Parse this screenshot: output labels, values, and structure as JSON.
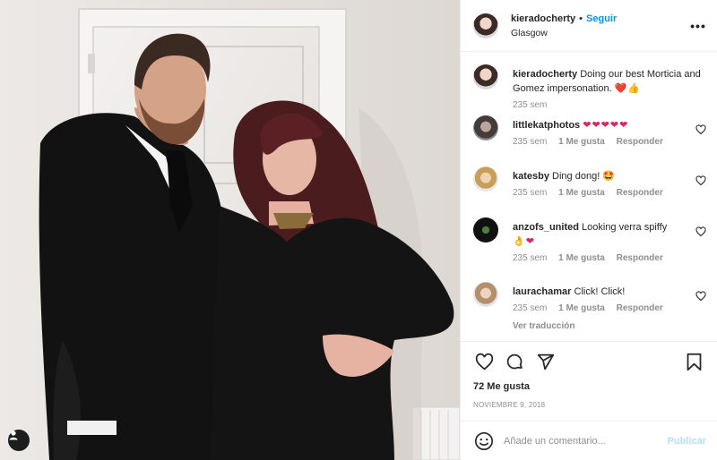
{
  "header": {
    "username": "kieradocherty",
    "separator": "•",
    "follow_label": "Seguir",
    "location": "Glasgow",
    "more_icon": "more-horizontal-icon"
  },
  "caption": {
    "username": "kieradocherty",
    "text": "Doing our best Morticia and Gomez impersonation.",
    "emoji": "❤️👍",
    "time": "235 sem"
  },
  "comments": [
    {
      "username": "littlekatphotos",
      "text": "",
      "emoji": "❤❤❤❤❤",
      "time": "235 sem",
      "likes": "1 Me gusta",
      "reply": "Responder"
    },
    {
      "username": "katesby",
      "text": "Ding dong!",
      "emoji": "🤩",
      "time": "235 sem",
      "likes": "1 Me gusta",
      "reply": "Responder"
    },
    {
      "username": "anzofs_united",
      "text": "Looking verra spiffy",
      "emoji": "👌❤",
      "time": "235 sem",
      "likes": "1 Me gusta",
      "reply": "Responder"
    },
    {
      "username": "laurachamar",
      "text": "Click! Click!",
      "emoji": "",
      "time": "235 sem",
      "likes": "1 Me gusta",
      "reply": "Responder",
      "translate": "Ver traducción"
    }
  ],
  "actions": {
    "like_icon": "heart-icon",
    "comment_icon": "comment-icon",
    "share_icon": "send-icon",
    "save_icon": "bookmark-icon"
  },
  "likes_label": "72 Me gusta",
  "date": "NOVIEMBRE 9, 2018",
  "add_comment": {
    "placeholder": "Añade un comentario...",
    "publish_label": "Publicar"
  },
  "colors": {
    "accent": "#0095f6",
    "publish_disabled": "#b2dffc",
    "muted": "#8e8e8e",
    "heart": "#ed4956"
  }
}
